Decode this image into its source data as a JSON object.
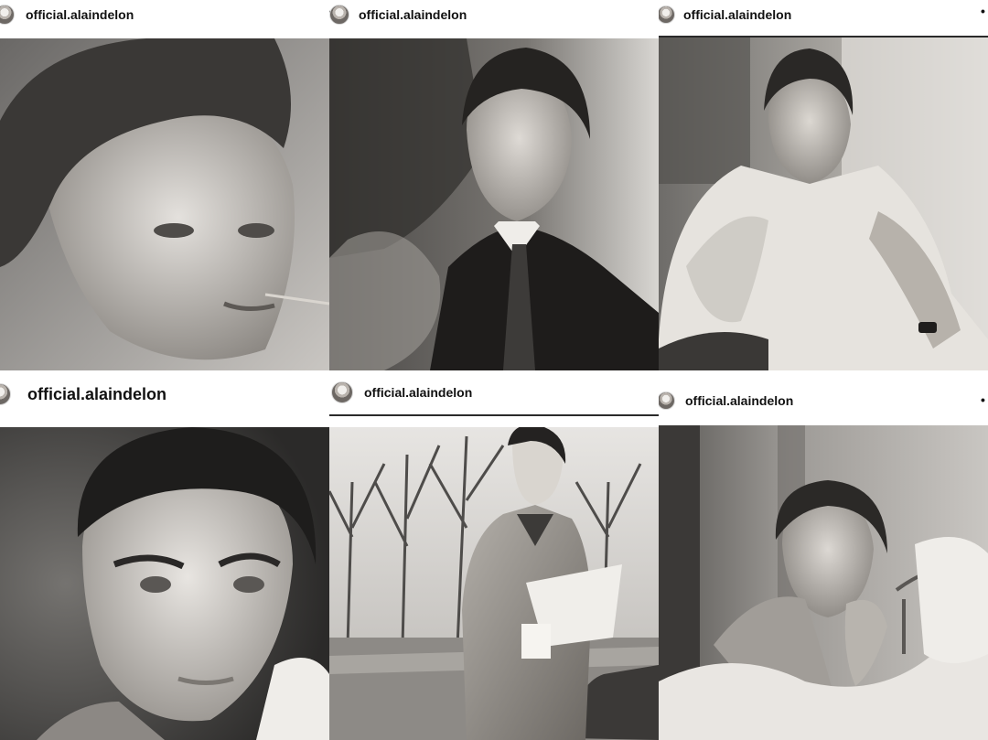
{
  "posts": [
    {
      "username": "official.alaindelon",
      "photo": "portrait-looking-up-with-toothpick"
    },
    {
      "username": "official.alaindelon",
      "photo": "portrait-in-suit-and-tie-smiling"
    },
    {
      "username": "official.alaindelon",
      "photo": "portrait-in-cable-knit-sweater"
    },
    {
      "username": "official.alaindelon",
      "photo": "closeup-portrait-intense-gaze"
    },
    {
      "username": "official.alaindelon",
      "photo": "standing-in-overcoat-reading-newspaper"
    },
    {
      "username": "official.alaindelon",
      "photo": "lying-in-bed-hand-on-chin"
    }
  ],
  "colors": {
    "background": "#ffffff",
    "text": "#111111"
  }
}
